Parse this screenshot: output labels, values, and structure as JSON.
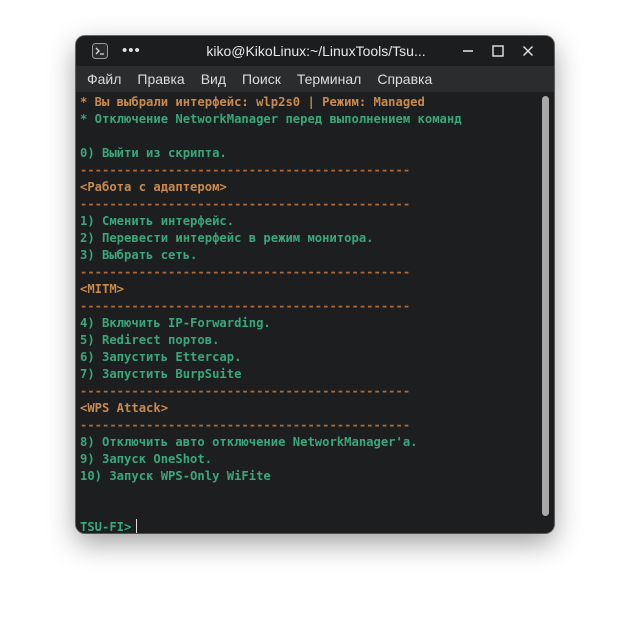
{
  "window": {
    "title": "kiko@KikoLinux:~/LinuxTools/Tsu...",
    "menu_dots": "•••"
  },
  "menubar": {
    "items": [
      "Файл",
      "Правка",
      "Вид",
      "Поиск",
      "Терминал",
      "Справка"
    ]
  },
  "terminal": {
    "lines": [
      {
        "text": "* Вы выбрали интерфейс: wlp2s0 | Режим: Managed",
        "kind": "orange"
      },
      {
        "text": "* Отключение NetworkManager перед выполнением команд",
        "kind": "green"
      },
      {
        "text": "",
        "kind": "green"
      },
      {
        "text": "0) Выйти из скрипта.",
        "kind": "green"
      },
      {
        "text": "---------------------------------------------",
        "kind": "sep"
      },
      {
        "text": "<Работа с адаптером>",
        "kind": "orange"
      },
      {
        "text": "---------------------------------------------",
        "kind": "sep"
      },
      {
        "text": "1) Сменить интерфейс.",
        "kind": "green"
      },
      {
        "text": "2) Перевести интерфейс в режим монитора.",
        "kind": "green"
      },
      {
        "text": "3) Выбрать сеть.",
        "kind": "green"
      },
      {
        "text": "---------------------------------------------",
        "kind": "sep"
      },
      {
        "text": "<MITM>",
        "kind": "orange"
      },
      {
        "text": "---------------------------------------------",
        "kind": "sep"
      },
      {
        "text": "4) Включить IP-Forwarding.",
        "kind": "green"
      },
      {
        "text": "5) Redirect портов.",
        "kind": "green"
      },
      {
        "text": "6) Запустить Ettercap.",
        "kind": "green"
      },
      {
        "text": "7) Запустить BurpSuite",
        "kind": "green"
      },
      {
        "text": "---------------------------------------------",
        "kind": "sep"
      },
      {
        "text": "<WPS Attack>",
        "kind": "orange"
      },
      {
        "text": "---------------------------------------------",
        "kind": "sep"
      },
      {
        "text": "8) Отключить авто отключение NetworkManager'a.",
        "kind": "green"
      },
      {
        "text": "9) Запуск OneShot.",
        "kind": "green"
      },
      {
        "text": "10) Запуск WPS-Only WiFite",
        "kind": "green"
      },
      {
        "text": "",
        "kind": "green"
      },
      {
        "text": "",
        "kind": "green"
      }
    ],
    "prompt": "TSU-FI>"
  },
  "colors": {
    "orange": "#c98a4e",
    "green": "#3aa77c",
    "separator": "#b06a3a",
    "background": "#1c1e1f"
  },
  "icons": [
    "terminal-app-icon",
    "menu-dots-icon",
    "minimize-icon",
    "maximize-icon",
    "close-icon"
  ]
}
